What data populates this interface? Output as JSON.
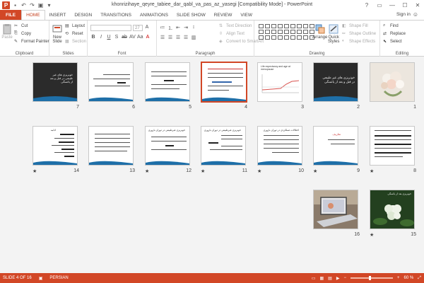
{
  "window": {
    "title": "khonrizihaye_qeyre_tabiee_dar_qabl_va_pas_az_yasegi [Compatibility Mode] - PowerPoint",
    "controls": [
      "?",
      "▭",
      "—",
      "☐",
      "✕"
    ]
  },
  "tabs": [
    "FILE",
    "HOME",
    "INSERT",
    "DESIGN",
    "TRANSITIONS",
    "ANIMATIONS",
    "SLIDE SHOW",
    "REVIEW",
    "VIEW"
  ],
  "signin": "Sign in",
  "ribbon": {
    "clipboard": {
      "label": "Clipboard",
      "paste": "Paste",
      "cut": "Cut",
      "copy": "Copy",
      "format_painter": "Format Painter"
    },
    "slides": {
      "label": "Slides",
      "new_slide_1": "New",
      "new_slide_2": "Slide",
      "layout": "Layout",
      "reset": "Reset",
      "section": "Section"
    },
    "font": {
      "label": "Font",
      "font_size": "27"
    },
    "paragraph": {
      "label": "Paragraph",
      "text_direction": "Text Direction",
      "align_text": "Align Text",
      "convert_smartart": "Convert to SmartArt"
    },
    "drawing": {
      "label": "Drawing",
      "arrange": "Arrange",
      "quick_styles_1": "Quick",
      "quick_styles_2": "Styles",
      "shape_fill": "Shape Fill",
      "shape_outline": "Shape Outline",
      "shape_effects": "Shape Effects"
    },
    "editing": {
      "label": "Editing",
      "find": "Find",
      "replace": "Replace",
      "select": "Select"
    }
  },
  "slides": [
    {
      "n": "1",
      "starred": false
    },
    {
      "n": "2",
      "starred": false,
      "title": "خونریزی های غیر طبیعی در قبل و بعد از یائسگی"
    },
    {
      "n": "3",
      "starred": false,
      "title": "Life expectancy and age at menopause"
    },
    {
      "n": "4",
      "starred": false,
      "selected": true
    },
    {
      "n": "5",
      "starred": false
    },
    {
      "n": "6",
      "starred": false
    },
    {
      "n": "7",
      "starred": false,
      "title": "خونریزی های غیر طبیعی در قبل و بعد از یائسگی"
    },
    {
      "n": "8",
      "starred": true
    },
    {
      "n": "9",
      "starred": true,
      "title": "تعاریف"
    },
    {
      "n": "10",
      "starred": true,
      "title": "اختلالات عملکردی در دوران باروری"
    },
    {
      "n": "11",
      "starred": true,
      "title": "خونریزی غیرطبیعی در دوران باروری"
    },
    {
      "n": "12",
      "starred": true,
      "title": "خونریزی غیرطبیعی در دوران باروری"
    },
    {
      "n": "13",
      "starred": false
    },
    {
      "n": "14",
      "starred": true,
      "title": "ادامه"
    },
    {
      "n": "15",
      "starred": true,
      "title": "خونریزی بعد از یائسگی"
    },
    {
      "n": "16",
      "starred": false
    }
  ],
  "status": {
    "slide_of": "SLIDE 4 OF 16",
    "language": "PERSIAN",
    "zoom": "60 %"
  },
  "colors": {
    "accent": "#d24726",
    "sorter_bg": "#f3f3f3",
    "swoosh": "#1e6fa8"
  }
}
